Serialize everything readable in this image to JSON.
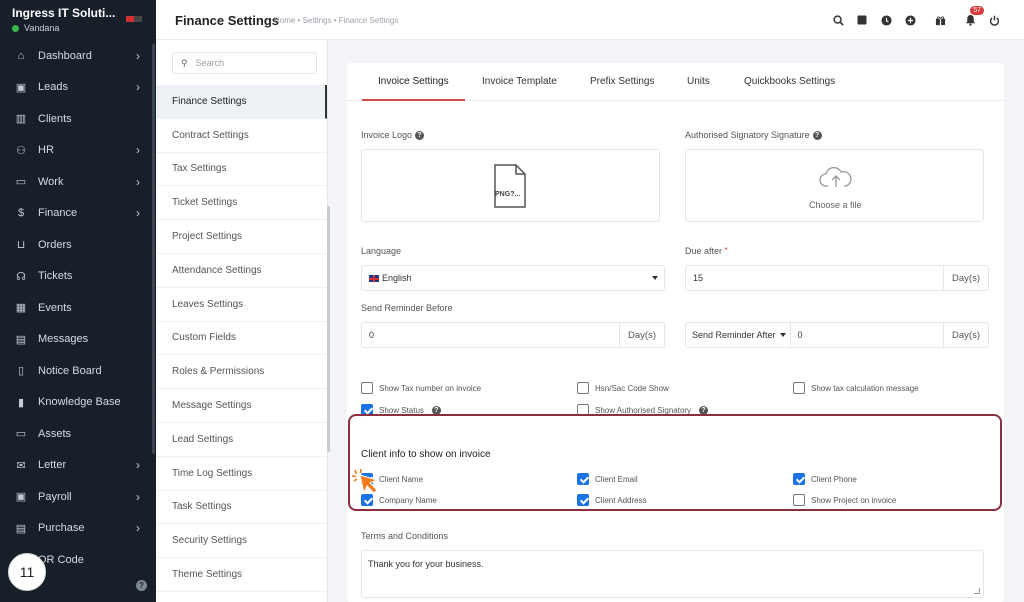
{
  "sidebar": {
    "company": "Ingress IT Soluti...",
    "user": "Vandana",
    "items": [
      {
        "label": "Dashboard",
        "icon": "home-icon",
        "chevron": true
      },
      {
        "label": "Leads",
        "icon": "leads-icon",
        "chevron": true
      },
      {
        "label": "Clients",
        "icon": "clients-icon",
        "chevron": false
      },
      {
        "label": "HR",
        "icon": "hr-icon",
        "chevron": true
      },
      {
        "label": "Work",
        "icon": "work-icon",
        "chevron": true
      },
      {
        "label": "Finance",
        "icon": "dollar-icon",
        "chevron": true
      },
      {
        "label": "Orders",
        "icon": "cart-icon",
        "chevron": false
      },
      {
        "label": "Tickets",
        "icon": "headset-icon",
        "chevron": false
      },
      {
        "label": "Events",
        "icon": "calendar-icon",
        "chevron": false
      },
      {
        "label": "Messages",
        "icon": "message-icon",
        "chevron": false
      },
      {
        "label": "Notice Board",
        "icon": "notice-icon",
        "chevron": false
      },
      {
        "label": "Knowledge Base",
        "icon": "book-icon",
        "chevron": false
      },
      {
        "label": "Assets",
        "icon": "monitor-icon",
        "chevron": false
      },
      {
        "label": "Letter",
        "icon": "mail-icon",
        "chevron": true
      },
      {
        "label": "Payroll",
        "icon": "payroll-icon",
        "chevron": true
      },
      {
        "label": "Purchase",
        "icon": "purchase-icon",
        "chevron": true
      },
      {
        "label": "QR Code",
        "icon": "qr-icon",
        "chevron": false
      }
    ],
    "step_badge": "11"
  },
  "topbar": {
    "title": "Finance Settings",
    "breadcrumb": "Home • Settings • Finance Settings",
    "notification_count": "57"
  },
  "submenu": {
    "search_placeholder": "Search",
    "items": [
      "Finance Settings",
      "Contract Settings",
      "Tax Settings",
      "Ticket Settings",
      "Project Settings",
      "Attendance Settings",
      "Leaves Settings",
      "Custom Fields",
      "Roles & Permissions",
      "Message Settings",
      "Lead Settings",
      "Time Log Settings",
      "Task Settings",
      "Security Settings",
      "Theme Settings"
    ],
    "active_index": 0
  },
  "tabs": [
    "Invoice Settings",
    "Invoice Template",
    "Prefix Settings",
    "Units",
    "Quickbooks Settings"
  ],
  "form": {
    "invoice_logo_label": "Invoice Logo",
    "file_placeholder": "PNG?...",
    "signature_label": "Authorised Signatory Signature",
    "choose_file": "Choose a file",
    "language_label": "Language",
    "language_value": "English",
    "due_after_label": "Due after",
    "due_after_value": "15",
    "days_unit": "Day(s)",
    "send_reminder_before_label": "Send Reminder Before",
    "send_reminder_before_value": "0",
    "send_reminder_after_select": "Send Reminder After",
    "send_reminder_after_value": "0",
    "checkboxes": [
      {
        "label": "Show Tax number on invoice",
        "checked": false
      },
      {
        "label": "Hsn/Sac Code Show",
        "checked": false
      },
      {
        "label": "Show tax calculation message",
        "checked": false
      },
      {
        "label": "Show Status",
        "checked": true,
        "help": true
      },
      {
        "label": "Show Authorised Signatory",
        "checked": false,
        "help": true
      }
    ],
    "client_info_title": "Client info to show on invoice",
    "client_info": [
      {
        "label": "Client Name",
        "checked": true
      },
      {
        "label": "Client Email",
        "checked": true
      },
      {
        "label": "Client Phone",
        "checked": true
      },
      {
        "label": "Company Name",
        "checked": true
      },
      {
        "label": "Client Address",
        "checked": true
      },
      {
        "label": "Show Project on invoice",
        "checked": false
      }
    ],
    "terms_label": "Terms and Conditions",
    "terms_value": "Thank you for your business."
  },
  "colors": {
    "accent": "#d44b4b",
    "sidebar_bg": "#171f29",
    "checkbox": "#1a73e8",
    "highlight": "#8b2f3e"
  }
}
